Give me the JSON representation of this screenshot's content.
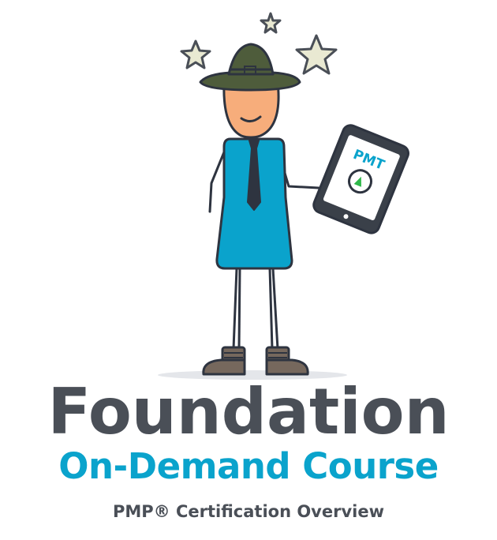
{
  "logo": {
    "tablet_badge": "PMT",
    "title": "Foundation",
    "subtitle": "On-Demand Course",
    "tagline": "PMP® Certification Overview"
  },
  "colors": {
    "title": "#4a4f57",
    "subtitle": "#0aa3cc",
    "shirt": "#0aa3cc",
    "hat": "#4e5c3b",
    "skin": "#f7ad7b",
    "boots": "#76685d",
    "outline": "#2e3440",
    "play": "#2fb84a"
  },
  "icons": [
    "star-icon",
    "ranger-hat-icon",
    "tablet-icon",
    "play-icon"
  ]
}
